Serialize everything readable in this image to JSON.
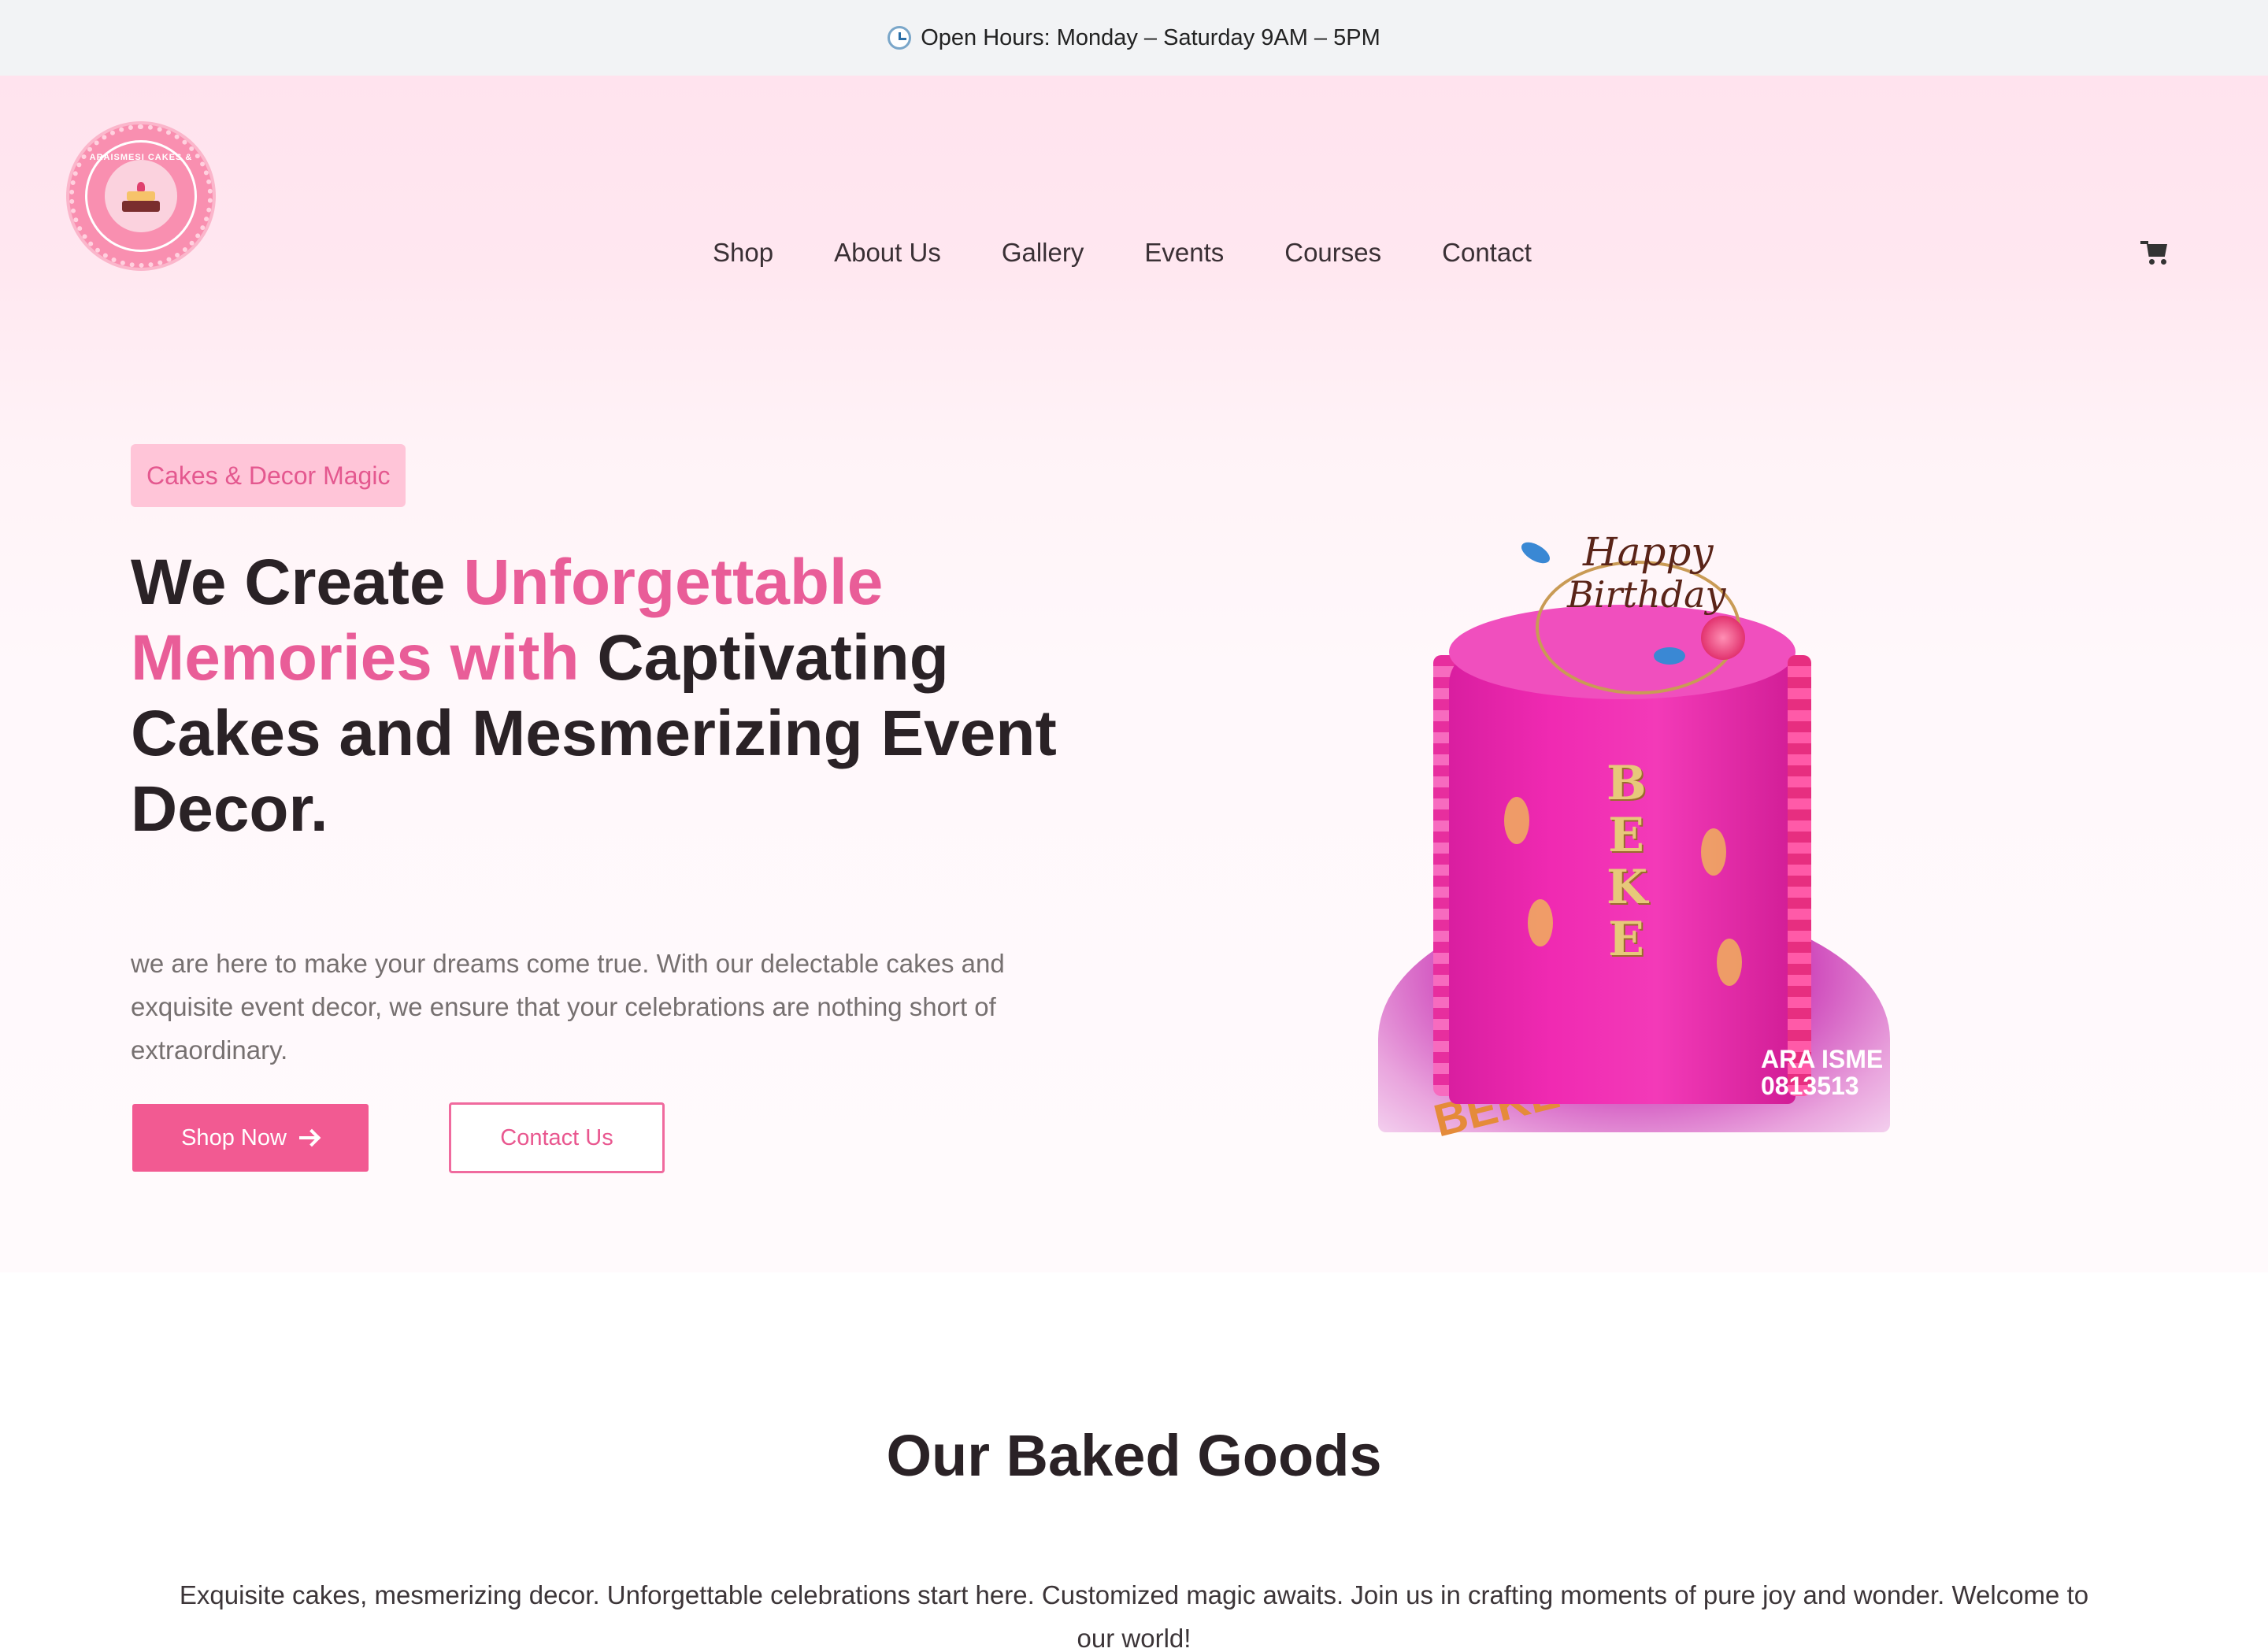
{
  "topbar": {
    "icon": "clock-icon",
    "text": "Open Hours: Monday – Saturday 9AM – 5PM"
  },
  "logo": {
    "text": "ARAISMESI CAKES & EVENT"
  },
  "nav": {
    "items": [
      "Shop",
      "About Us",
      "Gallery",
      "Events",
      "Courses",
      "Contact"
    ],
    "cart_icon": "cart-icon"
  },
  "hero": {
    "badge": "Cakes & Decor Magic",
    "headline": {
      "part1": "We Create ",
      "part2_pink": "Unforgettable Memories with",
      "part3": " Captivating Cakes and Mesmerizing Event Decor."
    },
    "intro": "we are here to make your dreams come true. With our delectable cakes and exquisite event decor, we ensure that your celebrations are nothing short of extraordinary.",
    "shop_button": "Shop Now",
    "contact_button": "Contact Us",
    "image": {
      "topper_line1": "Happy",
      "topper_line2": "Birthday",
      "cake_letters": [
        "B",
        "E",
        "K",
        "E"
      ],
      "watermark_line1": "ARA ISME",
      "watermark_line2": "0813513",
      "plate_text": "BEKE"
    }
  },
  "baked_goods": {
    "title": "Our Baked Goods",
    "description": "Exquisite cakes, mesmerizing decor. Unforgettable celebrations start here. Customized magic awaits. Join us in crafting moments of pure joy and wonder. Welcome to our world!"
  },
  "colors": {
    "accent": "#f25a92",
    "pink_text": "#e95d98",
    "topbar_bg": "#f2f3f5",
    "hero_bg": "#ffe3ee"
  }
}
